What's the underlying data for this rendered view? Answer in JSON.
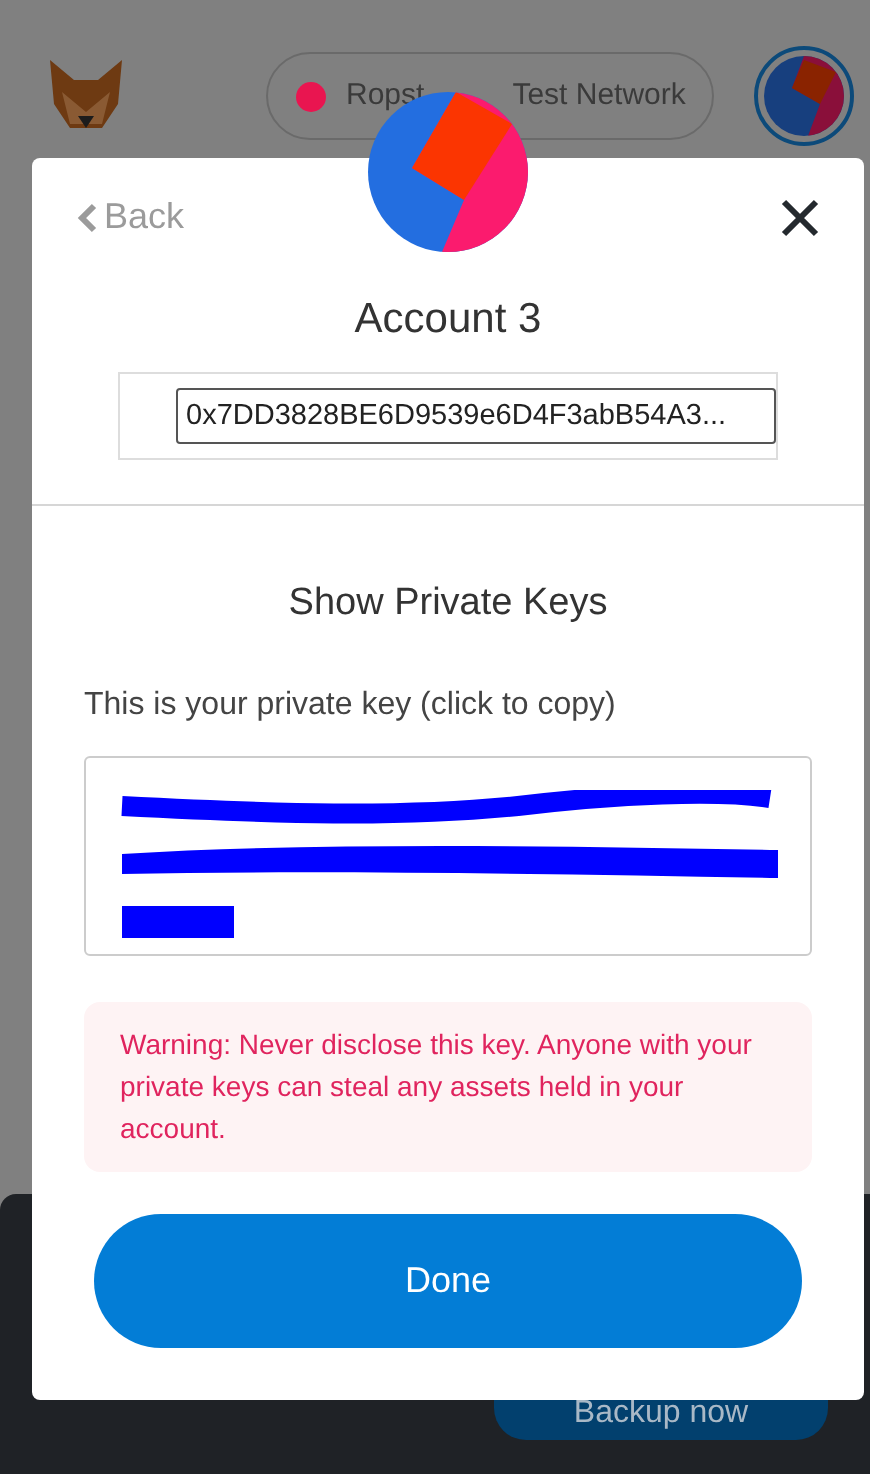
{
  "header": {
    "network": {
      "label_parts": [
        "Ropst",
        "Test Network"
      ],
      "color": "#e91550"
    }
  },
  "banner": {
    "button": "Backup now"
  },
  "modal": {
    "back": "Back",
    "account_name": "Account 3",
    "address": "0x7DD3828BE6D9539e6D4F3abB54A3...",
    "title": "Show Private Keys",
    "key_label": "This is your private key (click to copy)",
    "key_redacted": true,
    "warning": "Warning: Never disclose this key. Anyone with your private keys can steal any assets held in your account.",
    "done": "Done"
  }
}
